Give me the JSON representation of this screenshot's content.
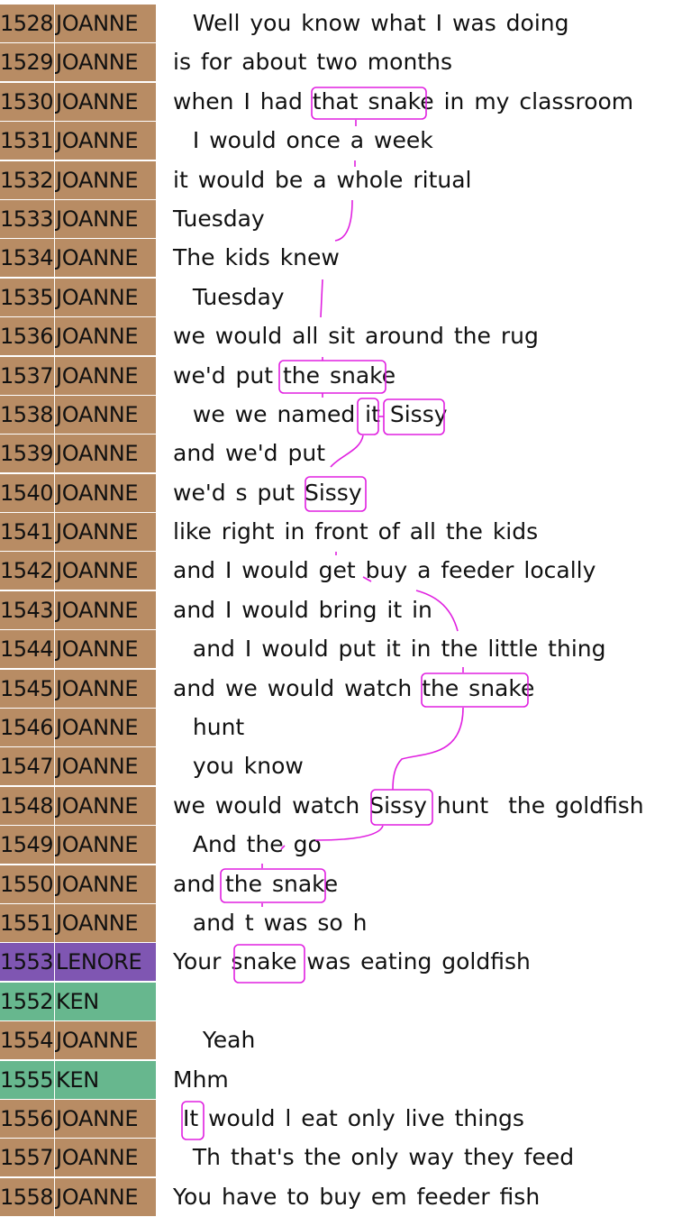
{
  "colors": {
    "JOANNE": "#b88c64",
    "LENORE": "#7f56b2",
    "KEN": "#67b78e",
    "annotation": "#e020e0"
  },
  "rows": [
    {
      "num": "1528",
      "speaker": "JOANNE",
      "text": "  Well you know what I was doing"
    },
    {
      "num": "1529",
      "speaker": "JOANNE",
      "text": "is for about two months"
    },
    {
      "num": "1530",
      "speaker": "JOANNE",
      "text": "when I had that snake in my classroom"
    },
    {
      "num": "1531",
      "speaker": "JOANNE",
      "text": "  I would once a week"
    },
    {
      "num": "1532",
      "speaker": "JOANNE",
      "text": "it would be a whole ritual"
    },
    {
      "num": "1533",
      "speaker": "JOANNE",
      "text": "Tuesday"
    },
    {
      "num": "1534",
      "speaker": "JOANNE",
      "text": "The kids knew"
    },
    {
      "num": "1535",
      "speaker": "JOANNE",
      "text": "  Tuesday"
    },
    {
      "num": "1536",
      "speaker": "JOANNE",
      "text": "we would all sit around the rug"
    },
    {
      "num": "1537",
      "speaker": "JOANNE",
      "text": "we'd put the snake"
    },
    {
      "num": "1538",
      "speaker": "JOANNE",
      "text": "  we we named it Sissy"
    },
    {
      "num": "1539",
      "speaker": "JOANNE",
      "text": "and we'd put"
    },
    {
      "num": "1540",
      "speaker": "JOANNE",
      "text": "we'd s put Sissy"
    },
    {
      "num": "1541",
      "speaker": "JOANNE",
      "text": "like right in front of all the kids"
    },
    {
      "num": "1542",
      "speaker": "JOANNE",
      "text": "and I would get buy a feeder locally"
    },
    {
      "num": "1543",
      "speaker": "JOANNE",
      "text": "and I would bring it in"
    },
    {
      "num": "1544",
      "speaker": "JOANNE",
      "text": "  and I would put it in the little thing"
    },
    {
      "num": "1545",
      "speaker": "JOANNE",
      "text": "and we would watch the snake"
    },
    {
      "num": "1546",
      "speaker": "JOANNE",
      "text": "  hunt"
    },
    {
      "num": "1547",
      "speaker": "JOANNE",
      "text": "  you know"
    },
    {
      "num": "1548",
      "speaker": "JOANNE",
      "text": "we would watch Sissy hunt  the goldfish"
    },
    {
      "num": "1549",
      "speaker": "JOANNE",
      "text": "  And the go"
    },
    {
      "num": "1550",
      "speaker": "JOANNE",
      "text": "and the snake"
    },
    {
      "num": "1551",
      "speaker": "JOANNE",
      "text": "  and t was so h"
    },
    {
      "num": "1553",
      "speaker": "LENORE",
      "text": "Your snake was eating goldfish"
    },
    {
      "num": "1552",
      "speaker": "KEN",
      "text": ""
    },
    {
      "num": "1554",
      "speaker": "JOANNE",
      "text": "   Yeah"
    },
    {
      "num": "1555",
      "speaker": "KEN",
      "text": "Mhm"
    },
    {
      "num": "1556",
      "speaker": "JOANNE",
      "text": " It would l eat only live things"
    },
    {
      "num": "1557",
      "speaker": "JOANNE",
      "text": "  Th that's the only way they feed"
    },
    {
      "num": "1558",
      "speaker": "JOANNE",
      "text": "You have to buy em feeder fish"
    }
  ],
  "mentions": [
    {
      "id": "m1530",
      "row": 2,
      "text": "that snake"
    },
    {
      "id": "m1537",
      "row": 9,
      "text": "the snake"
    },
    {
      "id": "m1538a",
      "row": 10,
      "text": "it"
    },
    {
      "id": "m1538b",
      "row": 10,
      "text": "Sissy"
    },
    {
      "id": "m1540",
      "row": 12,
      "text": "Sissy"
    },
    {
      "id": "m1545",
      "row": 17,
      "text": "the snake"
    },
    {
      "id": "m1548",
      "row": 20,
      "text": "Sissy"
    },
    {
      "id": "m1550",
      "row": 22,
      "text": "the snake"
    },
    {
      "id": "m1553",
      "row": 24,
      "text": "snake"
    },
    {
      "id": "m1556",
      "row": 28,
      "text": "It"
    }
  ]
}
